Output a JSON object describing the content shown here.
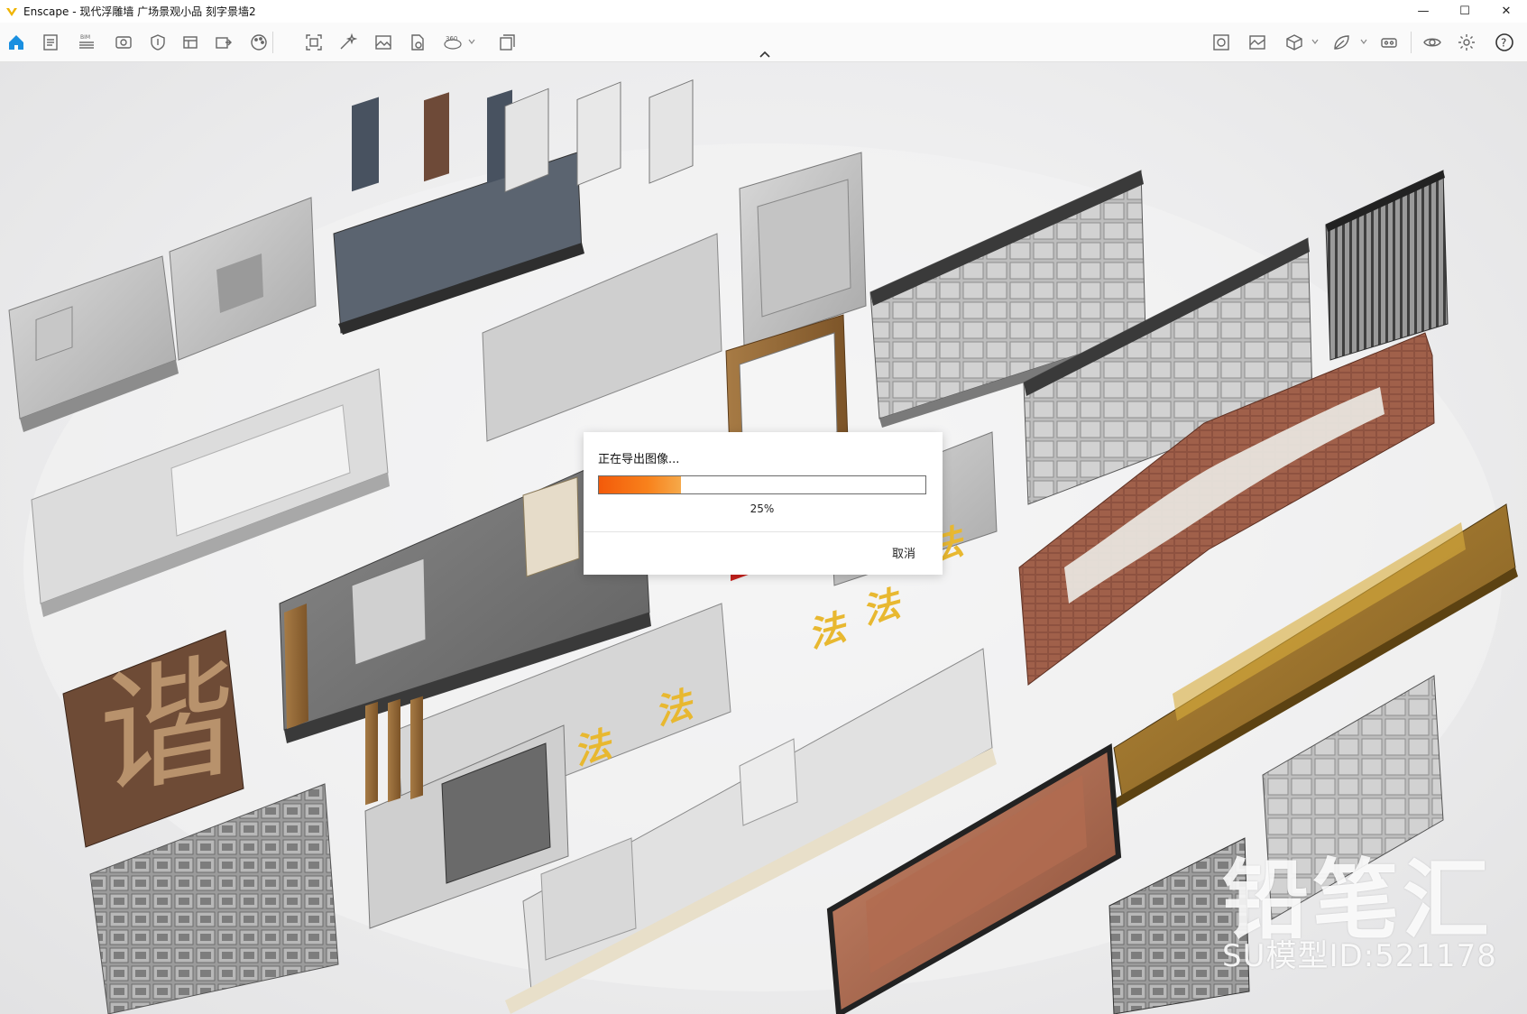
{
  "window": {
    "title": "Enscape - 现代浮雕墙 广场景观小品 刻字景墙2",
    "controls": {
      "minimize": "—",
      "maximize": "☐",
      "close": "✕"
    }
  },
  "toolbar": {
    "left_icons": [
      "home-icon",
      "document-icon",
      "bim-icon",
      "view-icon",
      "shield-icon",
      "layers-icon",
      "export-icon",
      "palette-icon",
      "screenshot-icon",
      "magic-icon",
      "image-icon",
      "document-export-icon",
      "panorama-360-icon",
      "batch-export-icon"
    ],
    "bim_label": "BIM",
    "panorama_label": "360",
    "right_icons": [
      "asset-library-icon",
      "image-settings-icon",
      "cube-icon",
      "leaf-icon",
      "vr-headset-icon",
      "eye-icon",
      "settings-icon",
      "help-icon"
    ],
    "help_label": "?"
  },
  "watermark": {
    "brand": "铅笔汇",
    "model_id": "SU模型ID:521178"
  },
  "dialog": {
    "title": "正在导出图像...",
    "progress": 0.25,
    "progress_text": "25%",
    "cancel_label": "取消"
  },
  "colors": {
    "accent": "#0e7fd0",
    "progress_start": "#f35a0a",
    "progress_end": "#f6a94a",
    "brand_yellow": "#f0b400"
  }
}
